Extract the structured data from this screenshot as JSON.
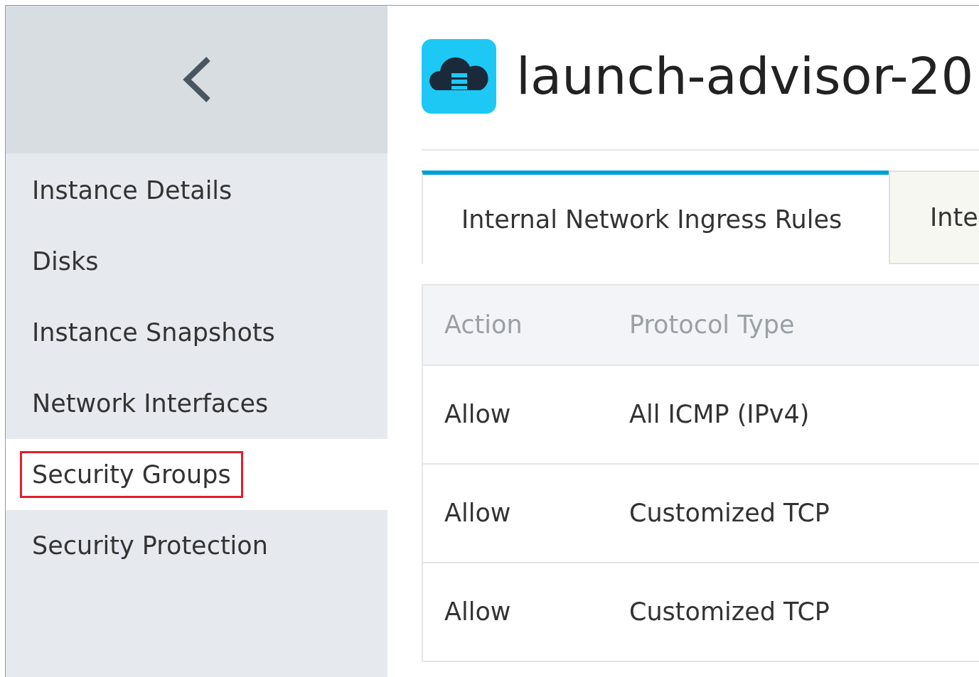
{
  "sidebar": {
    "items": [
      {
        "label": "Instance Details",
        "selected": false,
        "highlighted": false
      },
      {
        "label": "Disks",
        "selected": false,
        "highlighted": false
      },
      {
        "label": "Instance Snapshots",
        "selected": false,
        "highlighted": false
      },
      {
        "label": "Network Interfaces",
        "selected": false,
        "highlighted": false
      },
      {
        "label": "Security Groups",
        "selected": true,
        "highlighted": true
      },
      {
        "label": "Security Protection",
        "selected": false,
        "highlighted": false
      }
    ]
  },
  "header": {
    "title": "launch-advisor-20"
  },
  "tabs": [
    {
      "label": "Internal Network Ingress Rules",
      "selected": true
    },
    {
      "label": "Inte",
      "selected": false
    }
  ],
  "table": {
    "columns": [
      "Action",
      "Protocol Type"
    ],
    "rows": [
      [
        "Allow",
        "All ICMP (IPv4)"
      ],
      [
        "Allow",
        "Customized TCP"
      ],
      [
        "Allow",
        "Customized TCP"
      ]
    ]
  }
}
